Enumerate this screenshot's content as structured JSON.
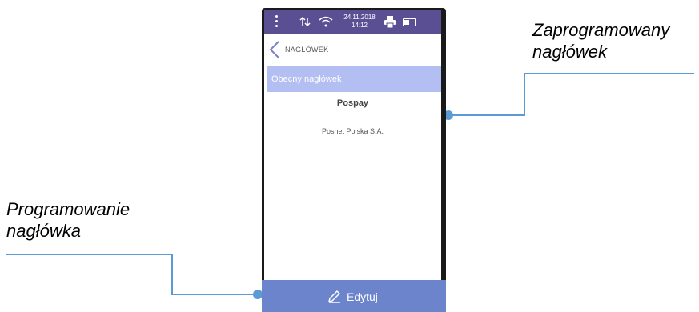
{
  "callouts": {
    "right": {
      "line1": "Zaprogramowany",
      "line2": "nagłówek"
    },
    "left": {
      "line1": "Programowanie",
      "line2": "nagłówka"
    }
  },
  "status_bar": {
    "date": "24.11.2018",
    "time": "14:12",
    "icons": [
      "menu-dots-icon",
      "sync-arrows-icon",
      "wifi-icon",
      "printer-icon",
      "battery-icon"
    ]
  },
  "header": {
    "title": "NAGŁÓWEK",
    "back_icon": "chevron-left-icon"
  },
  "section": {
    "label": "Obecny nagłówek"
  },
  "current_header": {
    "line1": "Pospay",
    "line2": "Posnet Polska S.A."
  },
  "footer": {
    "edit_label": "Edytuj",
    "edit_icon": "pencil-icon"
  },
  "colors": {
    "status_bar": "#5a4f93",
    "section_bar": "#b3bef2",
    "edit_button": "#6c84cc",
    "connector": "#5b9bd5"
  }
}
